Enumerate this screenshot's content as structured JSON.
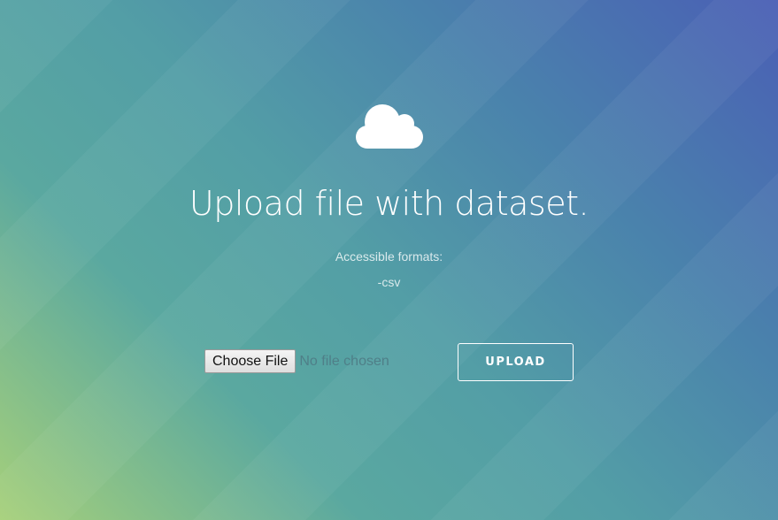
{
  "page": {
    "icon": "cloud-icon",
    "title": "Upload file with dataset.",
    "formats_label": "Accessible formats:",
    "formats": [
      "-csv"
    ]
  },
  "file_input": {
    "button_label": "Choose File",
    "status_text": "No file chosen"
  },
  "upload_button": {
    "label": "UPLOAD"
  },
  "colors": {
    "gradient_top_right": "#4a5fb5",
    "gradient_middle": "#539ea6",
    "gradient_bottom_left": "#a6d07a",
    "text": "#ffffff"
  }
}
